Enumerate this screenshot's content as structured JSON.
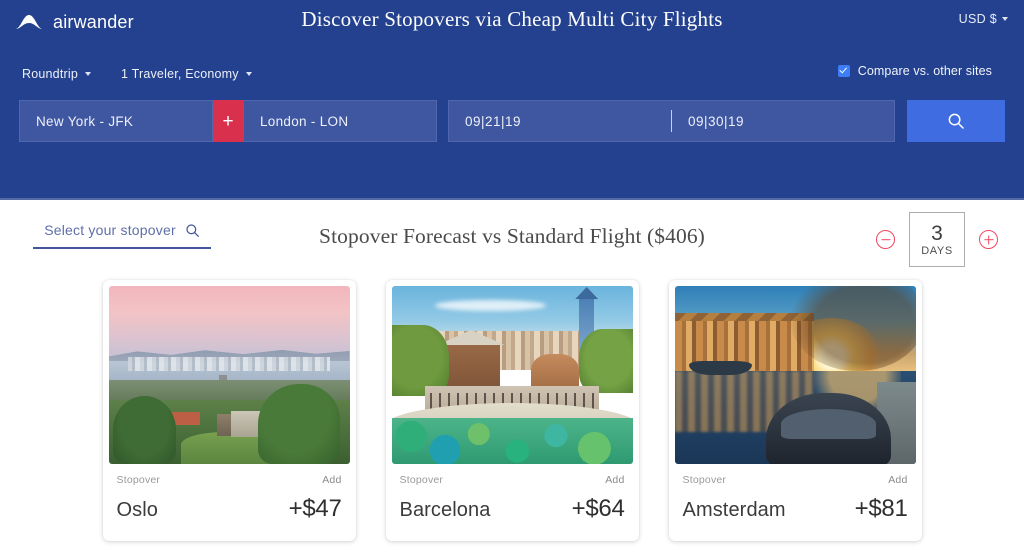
{
  "header": {
    "brand": "airwander",
    "title": "Discover Stopovers via Cheap Multi City Flights",
    "currency": "USD $",
    "trip_type": "Roundtrip",
    "travelers": "1 Traveler, Economy",
    "compare_label": "Compare vs. other sites",
    "compare_checked": true,
    "search": {
      "origin": "New York - JFK",
      "destination": "London - LON",
      "add_city_label": "+",
      "depart_date": "09|21|19",
      "return_date": "09|30|19",
      "search_icon": "search-icon"
    },
    "colors": {
      "header_bg": "#23418e",
      "field_bg": "#3f56a1",
      "add_button": "#d9304e",
      "search_button": "#3f6ce0",
      "checkbox": "#3d7df5"
    }
  },
  "main": {
    "stopover_picker_label": "Select your stopover",
    "forecast_title": "Stopover Forecast vs Standard Flight ($406)",
    "base_price": "$406",
    "days": {
      "value": "3",
      "unit": "DAYS",
      "decrement_label": "−",
      "increment_label": "+",
      "accent": "#f0465f"
    },
    "cards": [
      {
        "meta_left": "Stopover",
        "meta_right": "Add",
        "city": "Oslo",
        "price": "+$47",
        "photo": "oslo-fjord-sunset-photo"
      },
      {
        "meta_left": "Stopover",
        "meta_right": "Add",
        "city": "Barcelona",
        "price": "+$64",
        "photo": "barcelona-park-guell-photo"
      },
      {
        "meta_left": "Stopover",
        "meta_right": "Add",
        "city": "Amsterdam",
        "price": "+$81",
        "photo": "amsterdam-canal-sunset-photo"
      }
    ]
  }
}
